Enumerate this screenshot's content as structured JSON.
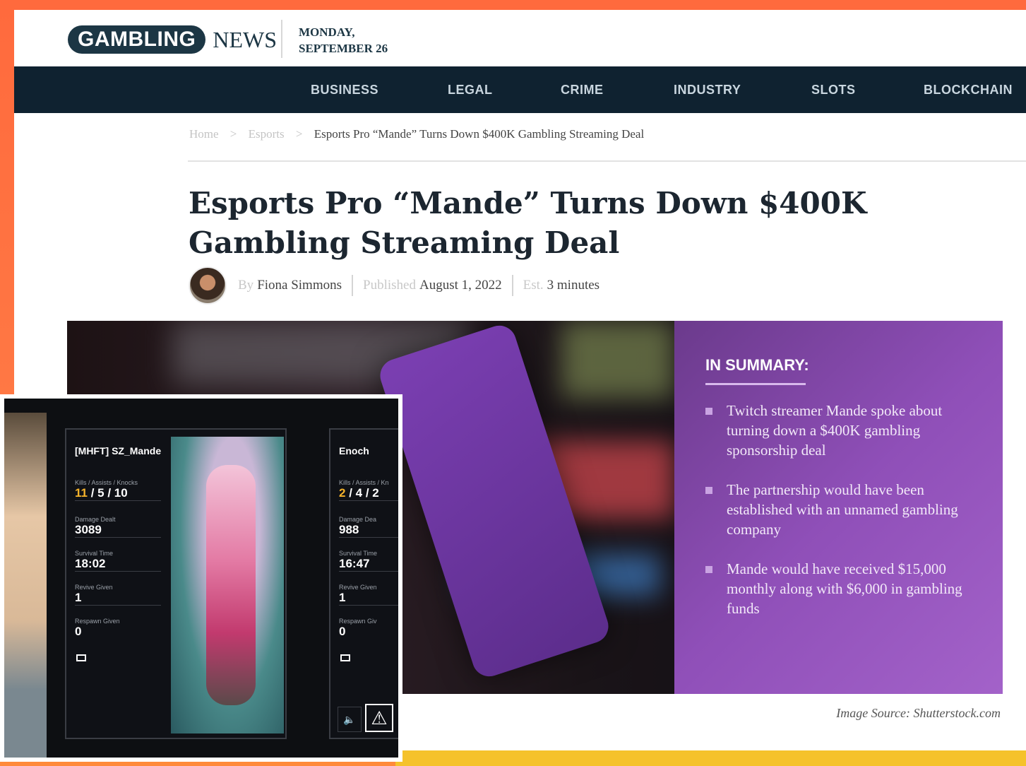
{
  "site": {
    "logo_word": "GAMBLING",
    "logo_news": "NEWS",
    "date_line1": "MONDAY,",
    "date_line2": "SEPTEMBER 26"
  },
  "nav": {
    "items": [
      "BUSINESS",
      "LEGAL",
      "CRIME",
      "INDUSTRY",
      "SLOTS",
      "BLOCKCHAIN"
    ]
  },
  "breadcrumb": {
    "home": "Home",
    "section": "Esports",
    "current": "Esports Pro “Mande” Turns Down $400K Gambling Streaming Deal",
    "separator": ">"
  },
  "article": {
    "title": "Esports Pro “Mande” Turns Down $400K Gambling Streaming Deal",
    "by_label": "By",
    "author": "Fiona Simmons",
    "published_label": "Published",
    "published_date": "August 1, 2022",
    "est_label": "Est.",
    "read_time": "3 minutes",
    "image_source": "Image Source: Shutterstock.com"
  },
  "summary": {
    "title": "IN SUMMARY:",
    "items": [
      "Twitch streamer Mande spoke about turning down a $400K gambling sponsorship deal",
      "The partnership would have been established with an unnamed gambling company",
      "Mande would have received $15,000 monthly along with $6,000 in gambling funds"
    ]
  },
  "game": {
    "players": [
      {
        "name": "[MHFT] SZ_Mande",
        "kills_label": "Kills / Assists / Knocks",
        "kills_first": "11",
        "kills_rest": " / 5 / 10",
        "damage_label": "Damage Dealt",
        "damage": "3089",
        "survival_label": "Survival Time",
        "survival": "18:02",
        "revive_label": "Revive Given",
        "revive": "1",
        "respawn_label": "Respawn Given",
        "respawn": "0"
      },
      {
        "name": "Enoch",
        "kills_label": "Kills / Assists / Kn",
        "kills_first": "2",
        "kills_rest": " / 4 / 2",
        "damage_label": "Damage Dea",
        "damage": "988",
        "survival_label": "Survival Time",
        "survival": "16:47",
        "revive_label": "Revive Given",
        "revive": "1",
        "respawn_label": "Respawn Giv",
        "respawn": "0"
      }
    ]
  },
  "colors": {
    "nav_bg": "#0f2230",
    "summary_bg": "#8f4fb8",
    "accent_orange": "#ff6a3d",
    "kills_highlight": "#f5b32b"
  }
}
